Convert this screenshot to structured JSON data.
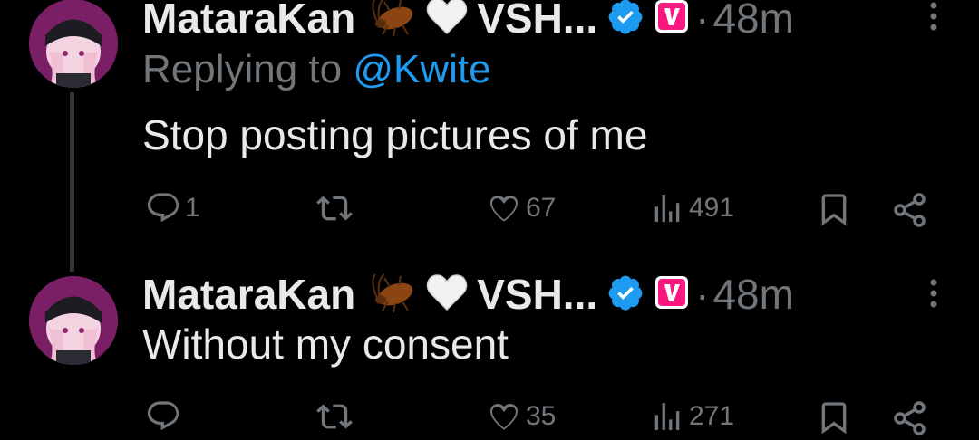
{
  "tweets": [
    {
      "author_name": "MataraKan",
      "handle_truncated": "VSH...",
      "separator": "·",
      "time": "48m",
      "replying_prefix": "Replying to",
      "replying_mention": "@Kwite",
      "text": "Stop posting pictures of me",
      "stats": {
        "replies": "1",
        "retweets": "",
        "likes": "67",
        "views": "491"
      }
    },
    {
      "author_name": "MataraKan",
      "handle_truncated": "VSH...",
      "separator": "·",
      "time": "48m",
      "text": "Without my consent",
      "stats": {
        "replies": "",
        "retweets": "",
        "likes": "35",
        "views": "271"
      }
    }
  ],
  "colors": {
    "background": "#000000",
    "text": "#e7e9ea",
    "muted": "#71767b",
    "link": "#1d9bf0",
    "verified": "#1d9bf0",
    "v_badge": "#f91880"
  },
  "icons": [
    "reply-icon",
    "retweet-icon",
    "like-icon",
    "views-icon",
    "bookmark-icon",
    "share-icon",
    "more-icon",
    "verified-icon",
    "cockroach-emoji",
    "white-heart-emoji"
  ]
}
